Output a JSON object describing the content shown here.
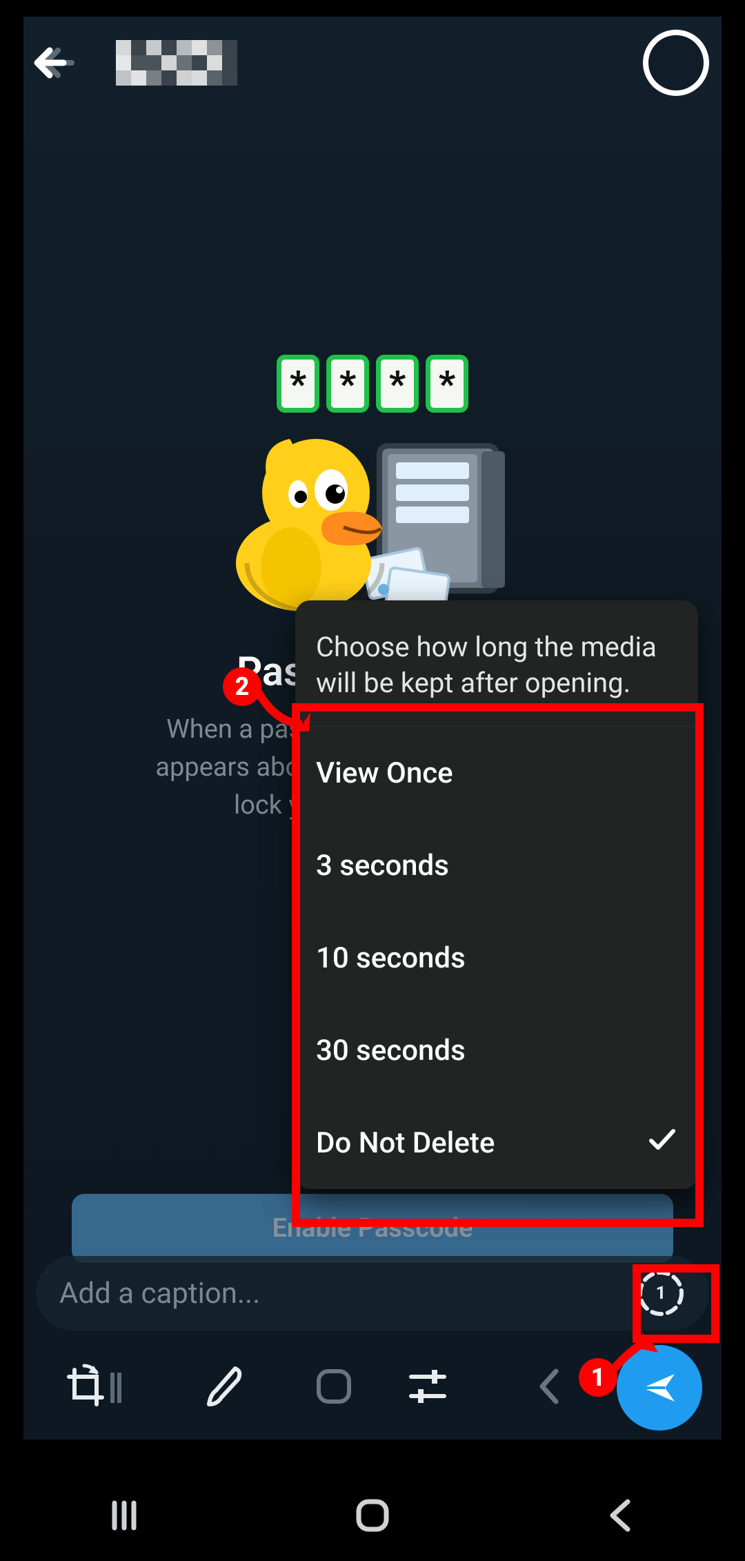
{
  "passcode": {
    "masked_chars": [
      "*",
      "*",
      "*",
      "*"
    ],
    "heading": "Passcode Lock",
    "subtitle": "When a passcode is set, a lock icon appears above your chat list. Tap it to lock your Telegram app.",
    "button_label": "Enable Passcode"
  },
  "popup": {
    "title": "Choose how long the media will be kept after opening.",
    "options": [
      {
        "label": "View Once",
        "selected": false
      },
      {
        "label": "3 seconds",
        "selected": false
      },
      {
        "label": "10 seconds",
        "selected": false
      },
      {
        "label": "30 seconds",
        "selected": false
      },
      {
        "label": "Do Not Delete",
        "selected": true
      }
    ]
  },
  "caption": {
    "placeholder": "Add a caption...",
    "timer_value": "1"
  },
  "annotations": {
    "badge1": "1",
    "badge2": "2"
  },
  "colors": {
    "accent_blue": "#1f9cf0",
    "accent_green": "#21c04a",
    "red": "#ff0000",
    "popup_bg": "#222323"
  }
}
